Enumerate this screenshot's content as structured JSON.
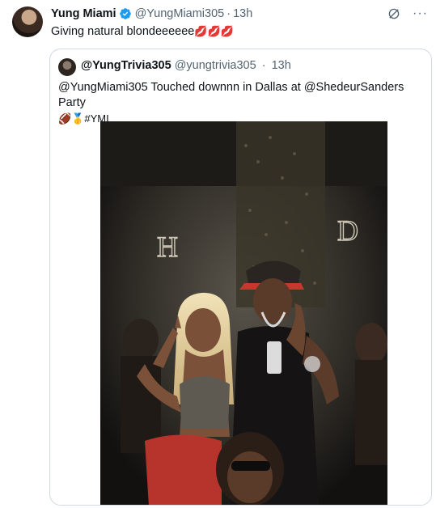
{
  "tweet": {
    "author_name": "Yung Miami",
    "author_handle": "@YungMiami305",
    "timestamp": "13h",
    "separator": "·",
    "text": "Giving natural blondeeeeee",
    "text_emojis": "💋💋💋"
  },
  "quoted_tweet": {
    "author_name": "@YungTrivia305",
    "author_handle": "@yungtrivia305",
    "timestamp": "13h",
    "separator": "·",
    "text": "@YungMiami305 Touched downnn in Dallas at @ShedeurSanders Party",
    "emojis": "🏈🥇#YMI"
  },
  "photo": {
    "sign_left": "H",
    "sign_right": "D"
  },
  "colors": {
    "verified": "#1d9bf0",
    "secondary_text": "#536471",
    "border": "#cfd9de"
  },
  "icons": [
    "verified-badge-icon",
    "grok-icon",
    "more-options-icon"
  ]
}
